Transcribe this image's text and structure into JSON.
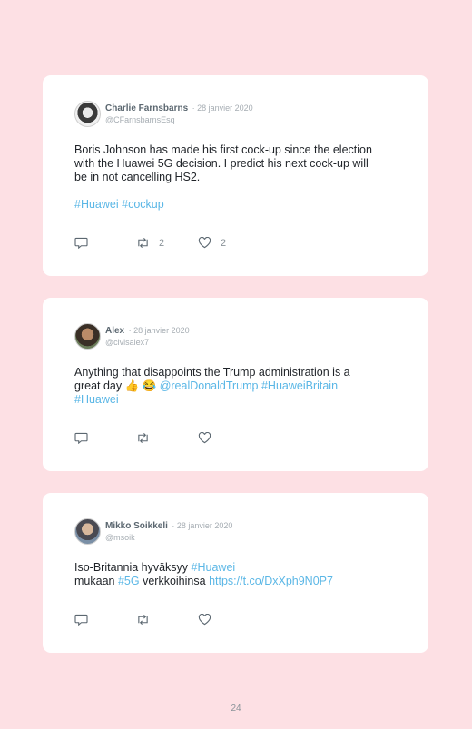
{
  "tweets": [
    {
      "name": "Charlie Farnsbarns",
      "date": "· 28 janvier 2020",
      "handle": "@CFarnsbarnsEsq",
      "line1": "Boris Johnson has made his first cock-up since the election",
      "line2": "with the Huawei 5G decision. I predict his next cock-up will",
      "line3": "be in not cancelling HS2.",
      "hashtags": "#Huawei #cockup",
      "retweets": "2",
      "likes": "2"
    },
    {
      "name": "Alex",
      "date": "· 28 janvier 2020",
      "handle": "@civisalex7",
      "line1": "Anything that disappoints the Trump administration is a",
      "line2_text": "great day",
      "line2_emoji": "👍 😂",
      "line2_links": "@realDonaldTrump #HuaweiBritain",
      "line3": "#Huawei",
      "retweets": "",
      "likes": ""
    },
    {
      "name": "Mikko Soikkeli",
      "date": "· 28 janvier 2020",
      "handle": "@msoik",
      "line1_text": "Iso-Britannia hyväksyy",
      "line1_link": "#Huawei",
      "line2_a": "mukaan",
      "line2_link": "#5G",
      "line2_b": "verkkoihinsa",
      "line2_url": "https://t.co/DxXph9N0P7",
      "retweets": "",
      "likes": ""
    }
  ],
  "page_number": "24",
  "colors": {
    "background": "#fde0e4",
    "card": "#ffffff",
    "link": "#5bb7e6"
  },
  "icons": [
    "reply-icon",
    "retweet-icon",
    "heart-icon"
  ]
}
